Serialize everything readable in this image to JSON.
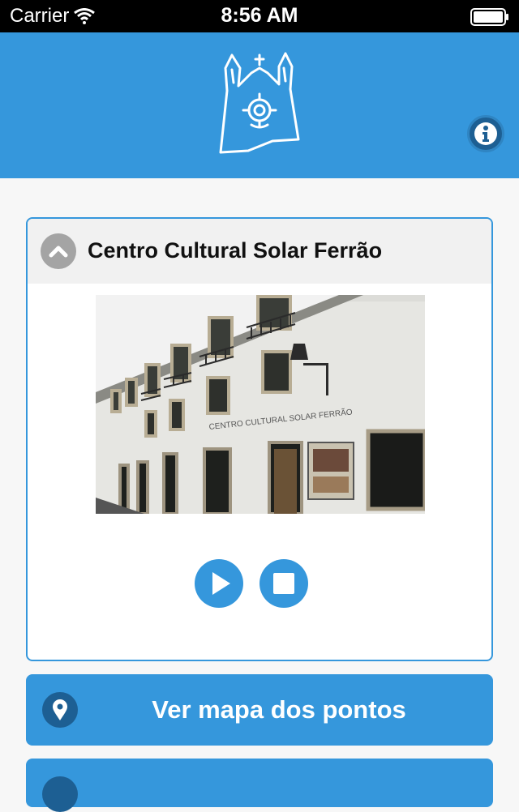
{
  "status_bar": {
    "carrier": "Carrier",
    "time": "8:56 AM"
  },
  "header": {
    "logo_icon": "church-sketch-logo",
    "info_icon": "info-icon"
  },
  "card": {
    "title": "Centro Cultural Solar Ferrão",
    "photo_sign": "CENTRO CULTURAL SOLAR FERRÃO",
    "collapse_icon": "chevron-up-icon",
    "play_icon": "play-icon",
    "stop_icon": "stop-icon"
  },
  "actions": {
    "map_label": "Ver mapa dos pontos",
    "map_icon": "map-pin-icon"
  },
  "colors": {
    "accent": "#3597dc",
    "dark_accent": "#1d5f93",
    "card_header": "#f1f1f1"
  }
}
